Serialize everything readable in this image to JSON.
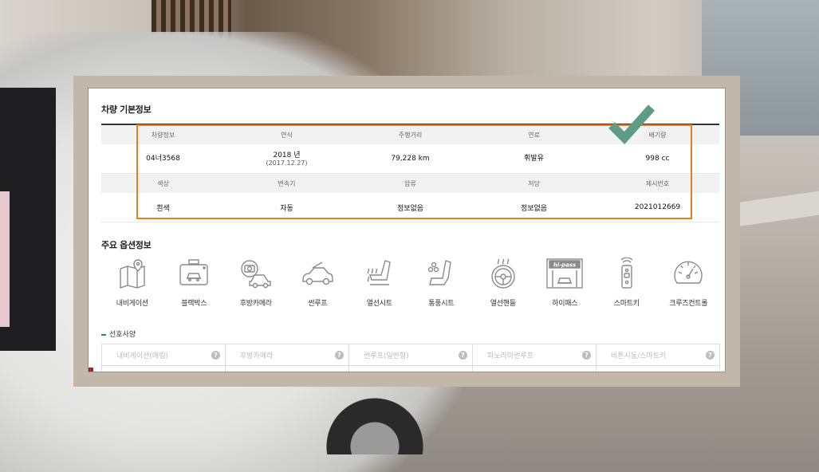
{
  "basic_info": {
    "title": "차량 기본정보",
    "headers_row1": [
      "차량정보",
      "연식",
      "주행거리",
      "연료",
      "배기량"
    ],
    "values_row1": [
      {
        "main": "04너3568",
        "sub": ""
      },
      {
        "main": "2018 년",
        "sub": "(2017.12.27)"
      },
      {
        "main": "79,228 km",
        "sub": ""
      },
      {
        "main": "휘발유",
        "sub": ""
      },
      {
        "main": "998 cc",
        "sub": ""
      }
    ],
    "headers_row2": [
      "색상",
      "변속기",
      "압류",
      "저당",
      "제시번호"
    ],
    "values_row2": [
      "흰색",
      "자동",
      "정보없음",
      "정보없음",
      "2021012669"
    ]
  },
  "options": {
    "title": "주요 옵션정보",
    "items": [
      {
        "label": "내비게이션",
        "icon": "navigation-icon"
      },
      {
        "label": "블랙박스",
        "icon": "blackbox-icon"
      },
      {
        "label": "후방카메라",
        "icon": "rear-camera-icon"
      },
      {
        "label": "썬루프",
        "icon": "sunroof-icon"
      },
      {
        "label": "열선시트",
        "icon": "heated-seat-icon"
      },
      {
        "label": "통풍시트",
        "icon": "ventilated-seat-icon"
      },
      {
        "label": "열선핸들",
        "icon": "heated-steering-icon"
      },
      {
        "label": "하이패스",
        "icon": "hipass-icon"
      },
      {
        "label": "스마트키",
        "icon": "smart-key-icon"
      },
      {
        "label": "크루즈컨트롤",
        "icon": "cruise-control-icon"
      }
    ],
    "hipass_text": "hi-pass"
  },
  "preferences": {
    "title": "선호사양",
    "row1": [
      "내비게이션(매립)",
      "후방카메라",
      "썬루프(일반형)",
      "파노라마썬루프",
      "버튼시동/스마트키"
    ],
    "help_glyph": "?"
  },
  "colors": {
    "highlight_border": "#f07a1e",
    "checkmark": "#5f9c84",
    "pref_bar": "#2d8c3c"
  }
}
